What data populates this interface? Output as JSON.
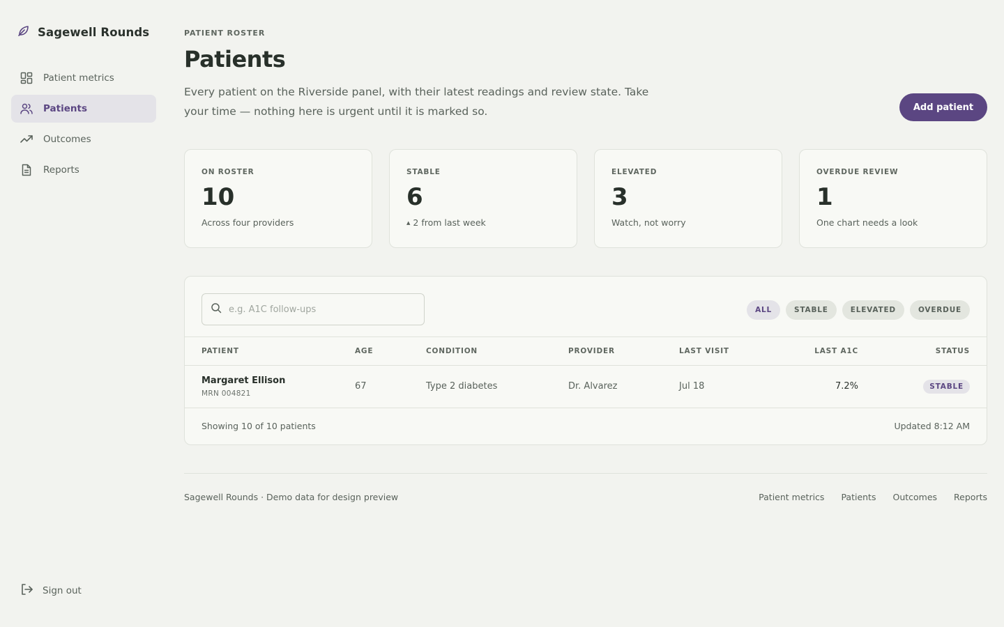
{
  "app": {
    "name": "Sagewell Rounds"
  },
  "colors": {
    "accent": "#5b4682",
    "background": "#f2f3ef",
    "card": "#f8f9f5"
  },
  "sidebar": {
    "items": [
      {
        "label": "Patient metrics",
        "icon": "grid-icon",
        "active": false
      },
      {
        "label": "Patients",
        "icon": "users-icon",
        "active": true
      },
      {
        "label": "Outcomes",
        "icon": "trending-up-icon",
        "active": false
      },
      {
        "label": "Reports",
        "icon": "document-icon",
        "active": false
      }
    ],
    "sign_out": "Sign out"
  },
  "header": {
    "eyebrow": "PATIENT ROSTER",
    "title": "Patients",
    "subtitle": "Every patient on the Riverside panel, with their latest readings and review state. Take your time — nothing here is urgent until it is marked so.",
    "add_button": "Add patient"
  },
  "stats": [
    {
      "label": "ON ROSTER",
      "value": "10",
      "note": "Across four providers"
    },
    {
      "label": "STABLE",
      "value": "6",
      "note_prefix": "▲",
      "note": "2 from last week"
    },
    {
      "label": "ELEVATED",
      "value": "3",
      "note": "Watch, not worry"
    },
    {
      "label": "OVERDUE REVIEW",
      "value": "1",
      "note": "One chart needs a look"
    }
  ],
  "search": {
    "placeholder": "e.g. A1C follow-ups",
    "value": ""
  },
  "filters": [
    "ALL",
    "STABLE",
    "ELEVATED",
    "OVERDUE"
  ],
  "active_filter": "ALL",
  "table": {
    "columns": [
      "PATIENT",
      "AGE",
      "CONDITION",
      "PROVIDER",
      "LAST VISIT",
      "LAST A1C",
      "STATUS"
    ],
    "rows": [
      {
        "name": "Margaret Ellison",
        "mrn": "MRN 004821",
        "age": "67",
        "condition": "Type 2 diabetes",
        "provider": "Dr. Alvarez",
        "last_visit": "Jul 18",
        "last_a1c": "7.2%",
        "status": "STABLE"
      }
    ],
    "showing": "Showing 10 of 10 patients",
    "updated": "Updated 8:12 AM"
  },
  "footer": {
    "text": "Sagewell Rounds · Demo data for design preview",
    "links": [
      "Patient metrics",
      "Patients",
      "Outcomes",
      "Reports"
    ]
  }
}
